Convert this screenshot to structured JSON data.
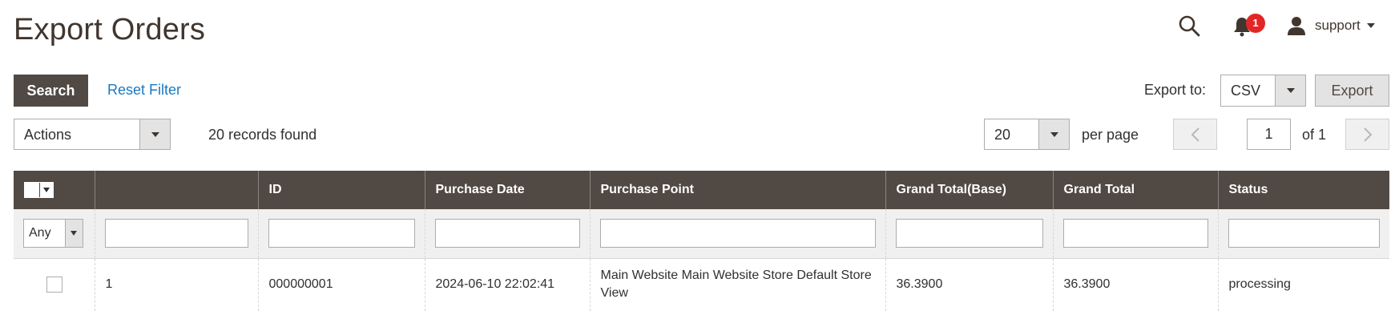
{
  "page": {
    "title": "Export Orders"
  },
  "header": {
    "notifications_count": "1",
    "user_name": "support"
  },
  "toolbar": {
    "search_label": "Search",
    "reset_filter_label": "Reset Filter",
    "export_to_label": "Export to:",
    "export_format": "CSV",
    "export_label": "Export",
    "actions_label": "Actions",
    "records_found": "20 records found",
    "per_page_value": "20",
    "per_page_label": "per page",
    "current_page": "1",
    "page_of": "of 1"
  },
  "grid": {
    "columns": [
      "",
      "",
      "ID",
      "Purchase Date",
      "Purchase Point",
      "Grand Total(Base)",
      "Grand Total",
      "Status"
    ],
    "filter_any": "Any",
    "rows": [
      {
        "index": "1",
        "id": "000000001",
        "purchase_date": "2024-06-10 22:02:41",
        "purchase_point": "Main Website Main Website Store Default Store View",
        "grand_total_base": "36.3900",
        "grand_total": "36.3900",
        "status": "processing"
      }
    ]
  },
  "colors": {
    "header_bg": "#514943",
    "link": "#1979c3",
    "badge": "#e22626"
  }
}
